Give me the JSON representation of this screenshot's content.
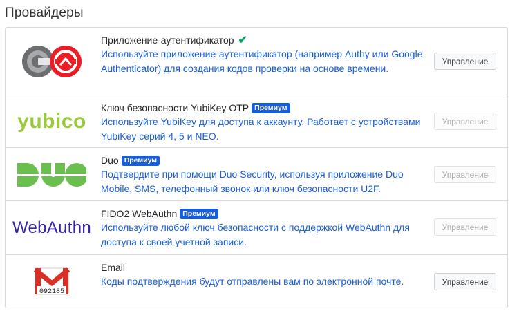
{
  "page": {
    "heading": "Провайдеры"
  },
  "providers": [
    {
      "title": "Приложение-аутентификатор",
      "description": "Используйте приложение-аутентификатор (например Authy или Google Authenticator) для создания кодов проверки на основе времени.",
      "button": "Управление",
      "enabled": true,
      "premium": false,
      "logo_icon": "authenticator-logo"
    },
    {
      "title": "Ключ безопасности YubiKey OTP",
      "badge": "Премиум",
      "description": "Используйте YubiKey для доступа к аккаунту. Работает с устройствами YubiKey серий 4, 5 и NEO.",
      "button": "Управление",
      "premium": true,
      "logo_text": "yubico"
    },
    {
      "title": "Duo",
      "badge": "Премиум",
      "description": "Подтвердите при помощи Duo Security, используя приложение Duo Mobile, SMS, телефонный звонок или ключ безопасности U2F.",
      "button": "Управление",
      "premium": true,
      "logo_icon": "duo-logo"
    },
    {
      "title": "FIDO2 WebAuthn",
      "badge": "Премиум",
      "description": "Используйте любой ключ безопасности с поддержкой WebAuthn для доступа к своей учетной записи.",
      "button": "Управление",
      "premium": true,
      "logo_text": "WebAuthn"
    },
    {
      "title": "Email",
      "description": "Коды подтверждения будут отправлены вам по электронной почте.",
      "button": "Управление",
      "premium": false,
      "logo_code": "092185",
      "logo_icon": "email-logo"
    }
  ],
  "colors": {
    "accent": "#175ddc",
    "check": "#01a05c",
    "yubico": "#9aca3c",
    "duo": "#6bbf4e",
    "webauthn": "#3423a6",
    "gmail_red": "#d93025"
  }
}
